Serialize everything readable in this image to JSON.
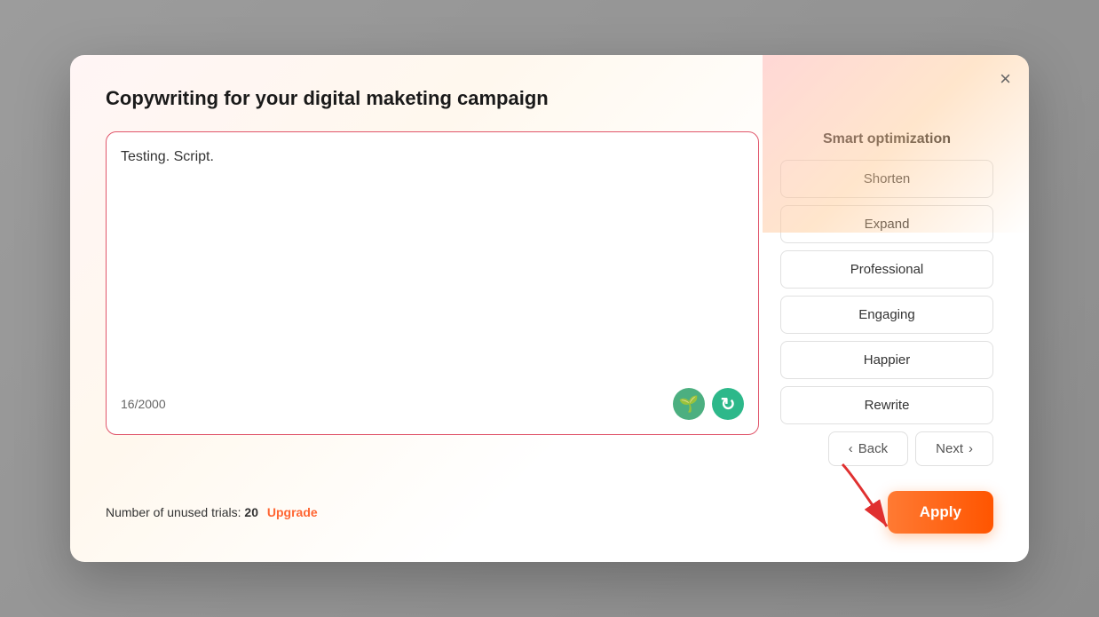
{
  "modal": {
    "title": "Copywriting for your digital maketing campaign",
    "close_label": "×",
    "textarea_value": "Testing. Script.",
    "textarea_placeholder": "",
    "char_count": "16/2000"
  },
  "smart_optimization": {
    "title": "Smart optimization",
    "options": [
      {
        "id": "shorten",
        "label": "Shorten"
      },
      {
        "id": "expand",
        "label": "Expand"
      },
      {
        "id": "professional",
        "label": "Professional"
      },
      {
        "id": "engaging",
        "label": "Engaging"
      },
      {
        "id": "happier",
        "label": "Happier"
      },
      {
        "id": "rewrite",
        "label": "Rewrite"
      }
    ]
  },
  "navigation": {
    "back_label": "Back",
    "next_label": "Next"
  },
  "footer": {
    "trials_prefix": "Number of unused trials:",
    "trials_count": "20",
    "upgrade_label": "Upgrade",
    "apply_label": "Apply"
  },
  "icons": {
    "leaf": "🌱",
    "refresh": "↻",
    "chevron_left": "‹",
    "chevron_right": "›"
  }
}
